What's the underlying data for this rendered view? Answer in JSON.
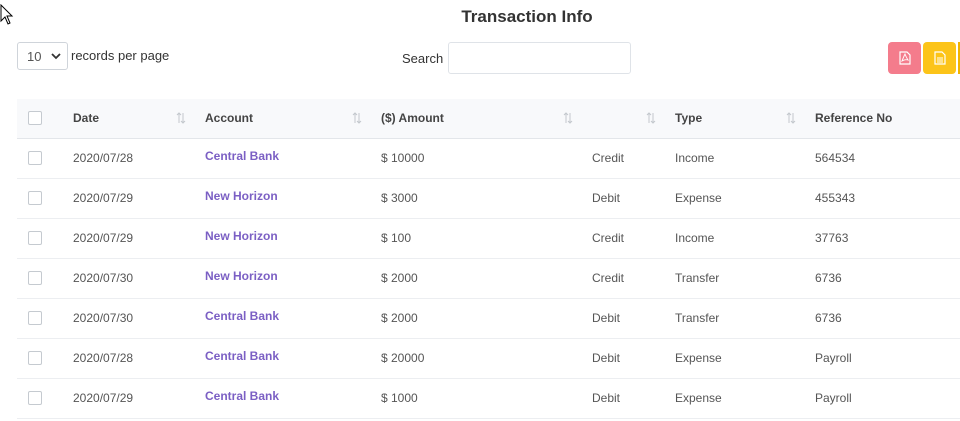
{
  "page": {
    "title": "Transaction Info"
  },
  "controls": {
    "page_length": "10",
    "page_length_suffix": "records per page",
    "search_label": "Search",
    "search_value": ""
  },
  "export_buttons": [
    {
      "name": "pdf-export-button",
      "color": "#f47c8c",
      "icon": "pdf-file-icon"
    },
    {
      "name": "document-export-button",
      "color": "#fcc419",
      "icon": "document-icon"
    }
  ],
  "table": {
    "columns": [
      {
        "label": ""
      },
      {
        "label": "Date"
      },
      {
        "label": "Account"
      },
      {
        "label": "($) Amount"
      },
      {
        "label": ""
      },
      {
        "label": "Type"
      },
      {
        "label": "Reference No"
      }
    ],
    "rows": [
      {
        "date": "2020/07/28",
        "account": "Central Bank",
        "amount": "$ 10000",
        "direction": "Credit",
        "type": "Income",
        "reference": "564534"
      },
      {
        "date": "2020/07/29",
        "account": "New Horizon",
        "amount": "$ 3000",
        "direction": "Debit",
        "type": "Expense",
        "reference": "455343"
      },
      {
        "date": "2020/07/29",
        "account": "New Horizon",
        "amount": "$ 100",
        "direction": "Credit",
        "type": "Income",
        "reference": "37763"
      },
      {
        "date": "2020/07/30",
        "account": "New Horizon",
        "amount": "$ 2000",
        "direction": "Credit",
        "type": "Transfer",
        "reference": "6736"
      },
      {
        "date": "2020/07/30",
        "account": "Central Bank",
        "amount": "$ 2000",
        "direction": "Debit",
        "type": "Transfer",
        "reference": "6736"
      },
      {
        "date": "2020/07/28",
        "account": "Central Bank",
        "amount": "$ 20000",
        "direction": "Debit",
        "type": "Expense",
        "reference": "Payroll"
      },
      {
        "date": "2020/07/29",
        "account": "Central Bank",
        "amount": "$ 1000",
        "direction": "Debit",
        "type": "Expense",
        "reference": "Payroll"
      }
    ]
  },
  "colors": {
    "accent_link": "#7b5fc4",
    "pdf_button": "#f47c8c",
    "doc_button": "#fcc419"
  }
}
